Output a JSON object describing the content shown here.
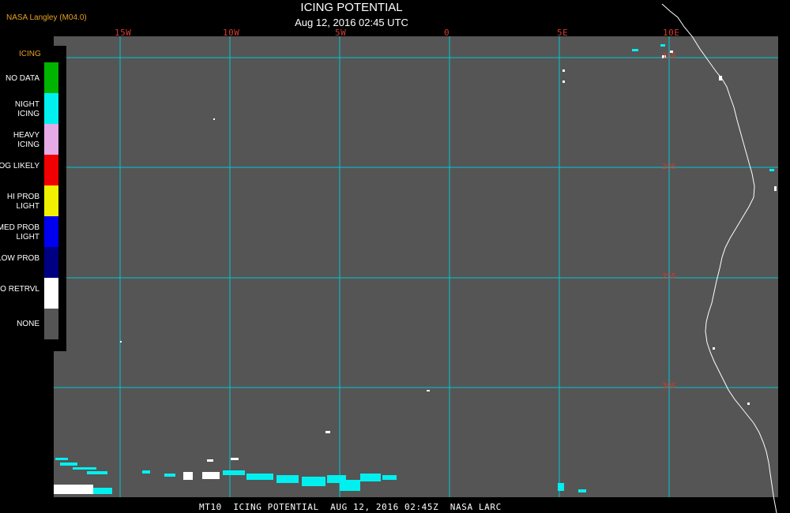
{
  "header": {
    "producer": "NASA Langley (M04.0)",
    "title": "ICING POTENTIAL",
    "subtitle": "Aug 12, 2016 02:45 UTC"
  },
  "map": {
    "lon_labels": [
      "15W",
      "10W",
      "5W",
      "0",
      "5E",
      "10E"
    ],
    "lat_labels": [
      "15S",
      "20S",
      "25S",
      "30S"
    ],
    "colors": {
      "background": "#555555",
      "grid": "#00c8d2",
      "coastline": "#ffffff",
      "grid_label": "#d23c32"
    }
  },
  "legend": {
    "title": "ICING",
    "items": [
      {
        "label": "NO DATA",
        "color": "#00b400"
      },
      {
        "label": "NIGHT ICING",
        "color": "#00f0f0"
      },
      {
        "label": "HEAVY ICING",
        "color": "#e6aae6"
      },
      {
        "label": "MOG LIKELY",
        "color": "#f00000"
      },
      {
        "label": "HI PROB LIGHT",
        "color": "#f0f000"
      },
      {
        "label": "MED PROB LIGHT",
        "color": "#0000f0"
      },
      {
        "label": "LOW PROB",
        "color": "#000082"
      },
      {
        "label": "NO RETRVL",
        "color": "#ffffff"
      },
      {
        "label": "NONE",
        "color": "#555555"
      }
    ]
  },
  "footer": {
    "caption": "MT10  ICING POTENTIAL  AUG 12, 2016 02:45Z  NASA LARC"
  }
}
